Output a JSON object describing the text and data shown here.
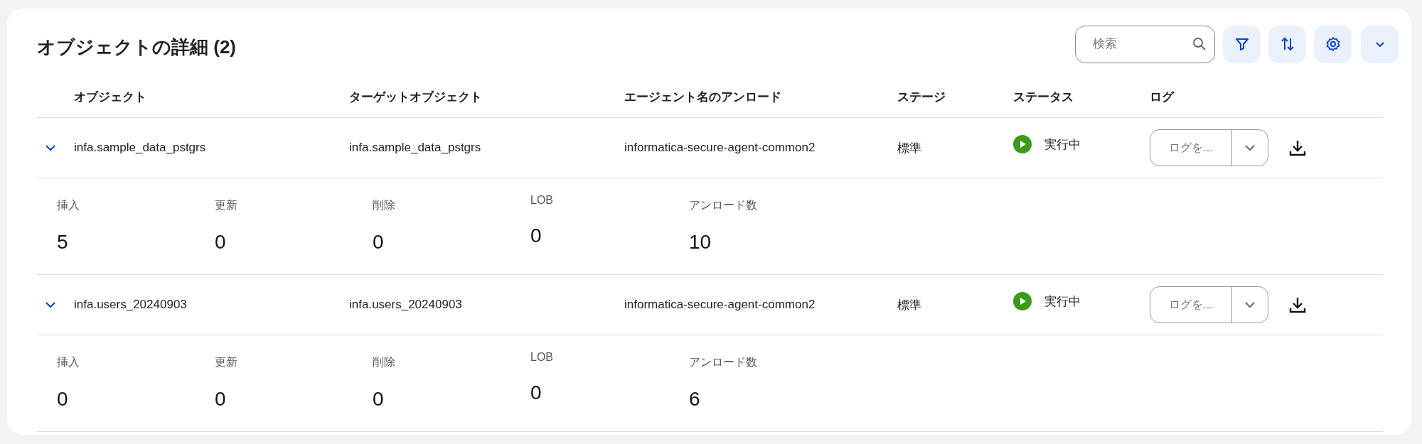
{
  "panel": {
    "title": "オブジェクトの詳細 (2)"
  },
  "toolbar": {
    "search": {
      "placeholder": "検索"
    },
    "buttons": [
      {
        "kind": "filter"
      },
      {
        "kind": "sort"
      },
      {
        "kind": "settings"
      },
      {
        "kind": "collapse"
      }
    ]
  },
  "table": {
    "columns": [
      "オブジェクト",
      "ターゲットオブジェクト",
      "エージェント名のアンロード",
      "ステージ",
      "ステータス",
      "ログ"
    ],
    "rows": [
      {
        "expanded": true,
        "object": "infa.sample_data_pstgrs",
        "target": "infa.sample_data_pstgrs",
        "agent": "informatica-secure-agent-common2",
        "stage": "標準",
        "status": {
          "kind": "running",
          "label": "実行中"
        },
        "log_select": {
          "placeholder": "ログを..."
        },
        "details": [
          {
            "label": "挿入",
            "value": "5"
          },
          {
            "label": "更新",
            "value": "0"
          },
          {
            "label": "削除",
            "value": "0"
          },
          {
            "label": "LOB",
            "value": "0"
          },
          {
            "label": "アンロード数",
            "value": "10"
          }
        ]
      },
      {
        "expanded": true,
        "object": "infa.users_20240903",
        "target": "infa.users_20240903",
        "agent": "informatica-secure-agent-common2",
        "stage": "標準",
        "status": {
          "kind": "running",
          "label": "実行中"
        },
        "log_select": {
          "placeholder": "ログを..."
        },
        "details": [
          {
            "label": "挿入",
            "value": "0"
          },
          {
            "label": "更新",
            "value": "0"
          },
          {
            "label": "削除",
            "value": "0"
          },
          {
            "label": "LOB",
            "value": "0"
          },
          {
            "label": "アンロード数",
            "value": "6"
          }
        ]
      }
    ]
  }
}
